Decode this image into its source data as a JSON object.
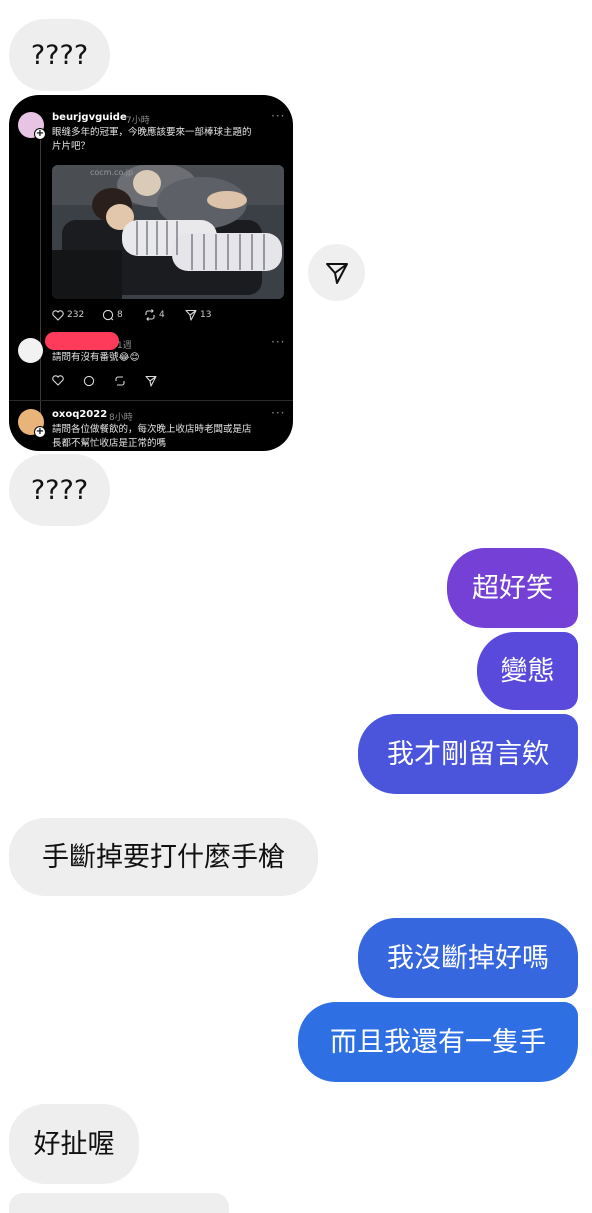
{
  "messages": [
    {
      "text": "????"
    },
    {
      "text": "????"
    },
    {
      "text": "超好笑"
    },
    {
      "text": "變態"
    },
    {
      "text": "我才剛留言欸"
    },
    {
      "text": "手斷掉要打什麼手槍"
    },
    {
      "text": "我沒斷掉好嗎"
    },
    {
      "text": "而且我還有一隻手"
    },
    {
      "text": "好扯喔"
    }
  ],
  "shared_post": {
    "author": "beurjgvguide",
    "time": "7小時",
    "caption_line1": "眼缝多年的冠軍，今晚應該要來一部棒球主題的",
    "caption_line2": "片片吧？",
    "watermark": "cocm.co.jp",
    "likes": "232",
    "comments": "8",
    "reposts": "4",
    "shares": "13",
    "reply_time": "1週",
    "reply_text": "請問有沒有番號",
    "reply_emoji": "😂😊",
    "next_author": "oxoq2022",
    "next_time": "8小時",
    "next_line1": "請問各位做餐飲的，每次晚上收店時老闆或是店",
    "next_line2": "長都不幫忙收店是正常的嗎"
  },
  "icons": {
    "share": "paper-plane-icon",
    "heart": "heart-icon",
    "comment": "comment-icon",
    "repost": "repost-icon",
    "more": "more-dots-icon"
  },
  "colors": {
    "received_bubble": "#eeeeee",
    "sent_top": "#7440d6",
    "sent_mid": "#4a55dc",
    "sent_bottom": "#2f6fe4",
    "redaction": "#ff3b5c"
  }
}
